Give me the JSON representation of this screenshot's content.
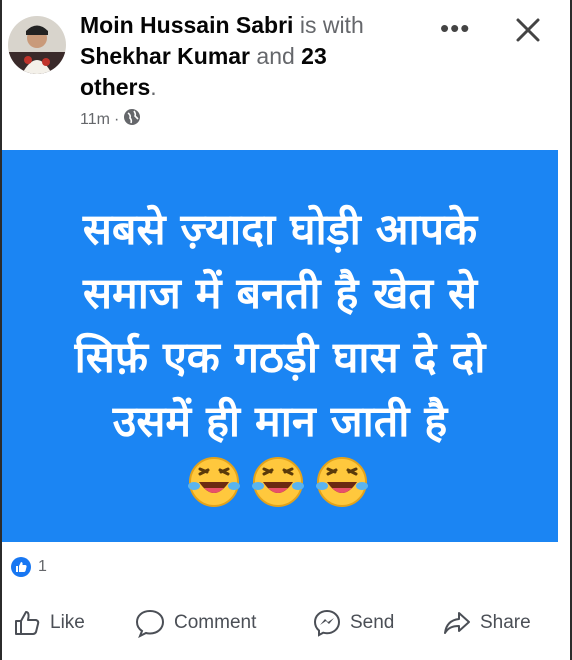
{
  "post": {
    "author": "Moin Hussain Sabri",
    "with_text": "is with",
    "tagged_person": "Shekhar Kumar",
    "and_text": "and",
    "others_count": "23",
    "others_text": "others",
    "period": ".",
    "time": "11m",
    "separator": "·",
    "privacy_icon": "globe-icon",
    "more_icon": "more-horizontal-icon",
    "close_icon": "close-icon"
  },
  "image": {
    "background_color": "#1b85f3",
    "lines": [
      "सबसे ज़्यादा घोड़ी आपके",
      "समाज में बनती है खेत से",
      "सिर्फ़ एक गठड़ी घास दे दो",
      "उसमें ही मान जाती है"
    ],
    "emoji": [
      "laughing-face",
      "laughing-face",
      "laughing-face"
    ]
  },
  "reactions": {
    "icon": "like-reaction-icon",
    "count": "1"
  },
  "actions": {
    "like": "Like",
    "comment": "Comment",
    "send": "Send",
    "share": "Share"
  }
}
